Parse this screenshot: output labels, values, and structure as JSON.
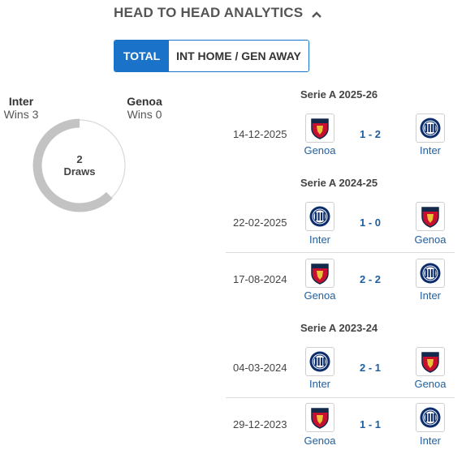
{
  "header": {
    "title": "HEAD TO HEAD ANALYTICS",
    "collapse_icon": "chevron-up-icon"
  },
  "tabs": [
    {
      "label": "TOTAL",
      "active": true
    },
    {
      "label": "INT HOME / GEN AWAY",
      "active": false
    }
  ],
  "summary": {
    "home": {
      "name": "Inter",
      "wins": "Wins 3"
    },
    "away": {
      "name": "Genoa",
      "wins": "Wins 0"
    },
    "draws_count": "2",
    "draws_label": "Draws",
    "donut_colors": {
      "inter": "#c3c3c3",
      "draws": "#e0e0e0"
    }
  },
  "seasons": [
    {
      "label": "Serie A 2025-26",
      "matches": [
        {
          "date": "14-12-2025",
          "home": "Genoa",
          "home_icon": "genoa-crest-icon",
          "score": "1  -  2",
          "away": "Inter",
          "away_icon": "inter-crest-icon"
        }
      ]
    },
    {
      "label": "Serie A 2024-25",
      "matches": [
        {
          "date": "22-02-2025",
          "home": "Inter",
          "home_icon": "inter-crest-icon",
          "score": "1  -  0",
          "away": "Genoa",
          "away_icon": "genoa-crest-icon"
        },
        {
          "date": "17-08-2024",
          "home": "Genoa",
          "home_icon": "genoa-crest-icon",
          "score": "2  -  2",
          "away": "Inter",
          "away_icon": "inter-crest-icon"
        }
      ]
    },
    {
      "label": "Serie A 2023-24",
      "matches": [
        {
          "date": "04-03-2024",
          "home": "Inter",
          "home_icon": "inter-crest-icon",
          "score": "2  -  1",
          "away": "Genoa",
          "away_icon": "genoa-crest-icon"
        },
        {
          "date": "29-12-2023",
          "home": "Genoa",
          "home_icon": "genoa-crest-icon",
          "score": "1  -  1",
          "away": "Inter",
          "away_icon": "inter-crest-icon"
        }
      ]
    }
  ],
  "colors": {
    "accent": "#1a73c9",
    "score": "#1f5fa0",
    "genoa_red": "#c8102e",
    "genoa_blue": "#13294b",
    "inter_blue": "#0c2d6b"
  }
}
